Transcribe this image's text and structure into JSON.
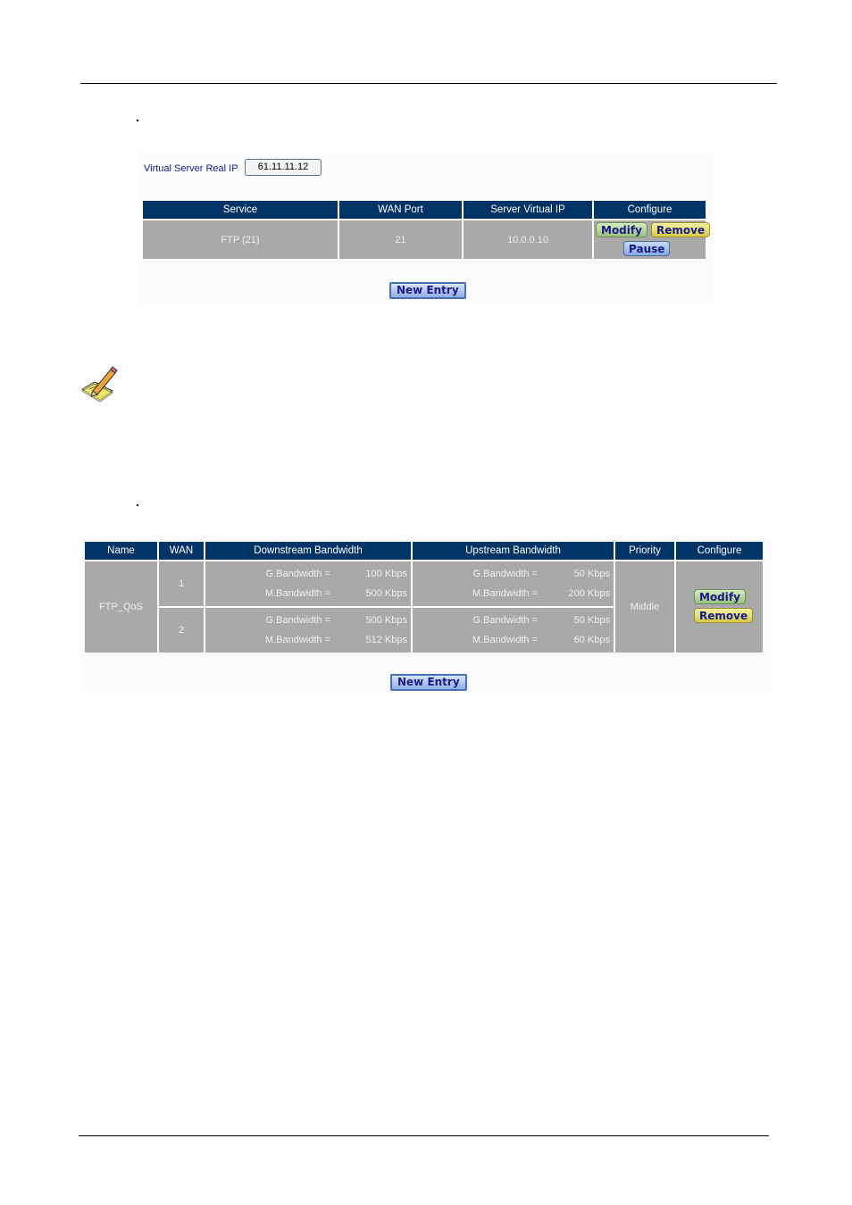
{
  "page": {
    "bullet1": ".",
    "bullet2": "."
  },
  "virtual_server": {
    "real_ip_label": "Virtual Server Real IP",
    "real_ip_value": "61.11.11.12",
    "columns": [
      "Service",
      "WAN Port",
      "Server Virtual IP",
      "Configure"
    ],
    "rows": [
      {
        "service": "FTP (21)",
        "wan_port": "21",
        "server_virtual_ip": "10.0.0.10",
        "actions": {
          "modify": "Modify",
          "remove": "Remove",
          "pause": "Pause"
        }
      }
    ],
    "new_entry_label": "New Entry"
  },
  "note": {
    "icon": "note-pencil-icon"
  },
  "qos": {
    "columns": [
      "Name",
      "WAN",
      "Downstream Bandwidth",
      "Upstream Bandwidth",
      "Priority",
      "Configure"
    ],
    "rows": [
      {
        "name": "FTP_QoS",
        "priority": "Middle",
        "wans": [
          {
            "wan": "1",
            "down": {
              "g_label": "G.Bandwidth =",
              "g_value": "100 Kbps",
              "m_label": "M.Bandwidth =",
              "m_value": "500 Kbps"
            },
            "up": {
              "g_label": "G.Bandwidth =",
              "g_value": "50 Kbps",
              "m_label": "M.Bandwidth =",
              "m_value": "200 Kbps"
            }
          },
          {
            "wan": "2",
            "down": {
              "g_label": "G.Bandwidth =",
              "g_value": "500 Kbps",
              "m_label": "M.Bandwidth =",
              "m_value": "512 Kbps"
            },
            "up": {
              "g_label": "G.Bandwidth =",
              "g_value": "50 Kbps",
              "m_label": "M.Bandwidth =",
              "m_value": "60 Kbps"
            }
          }
        ],
        "actions": {
          "modify": "Modify",
          "remove": "Remove"
        }
      }
    ],
    "new_entry_label": "New Entry"
  }
}
